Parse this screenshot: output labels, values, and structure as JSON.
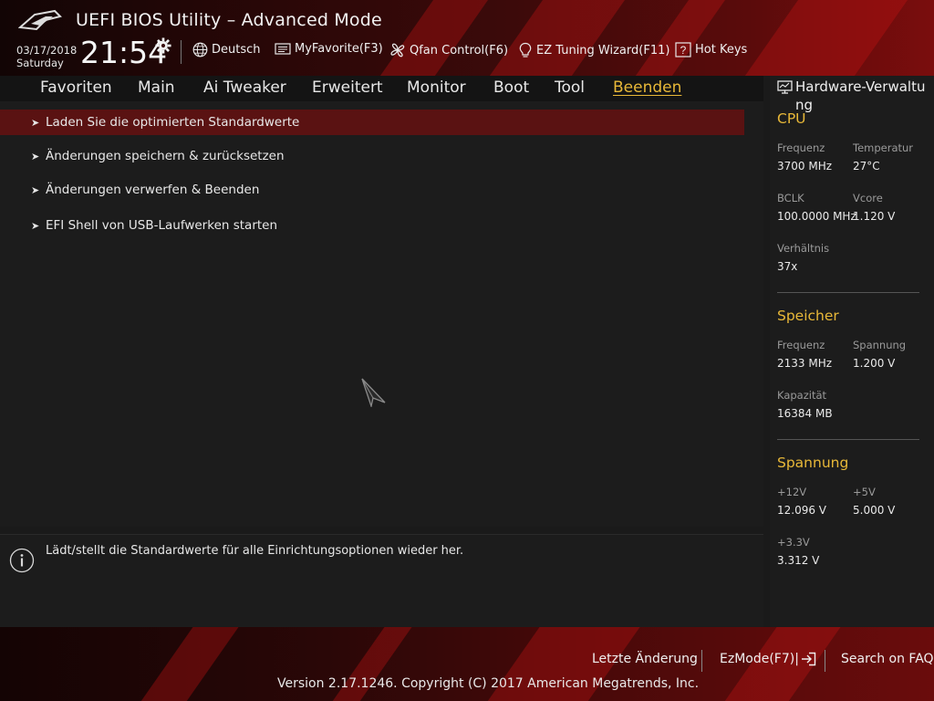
{
  "header": {
    "title": "UEFI BIOS Utility – Advanced Mode",
    "date": "03/17/2018",
    "weekday": "Saturday",
    "time": "21:54",
    "toolbar": {
      "language": "Deutsch",
      "myfavorite": "MyFavorite(F3)",
      "qfan": "Qfan Control(F6)",
      "ez_tuning": "EZ Tuning Wizard(F11)",
      "hotkeys": "Hot Keys"
    }
  },
  "tabs": [
    "Favoriten",
    "Main",
    "Ai Tweaker",
    "Erweitert",
    "Monitor",
    "Boot",
    "Tool",
    "Beenden"
  ],
  "active_tab": "Beenden",
  "menu": {
    "items": [
      {
        "label": "Laden Sie die optimierten Standardwerte",
        "selected": true
      },
      {
        "label": "Änderungen speichern & zurücksetzen",
        "selected": false
      },
      {
        "label": "Änderungen verwerfen & Beenden",
        "selected": false
      },
      {
        "label": "EFI Shell von USB-Laufwerken starten",
        "selected": false
      }
    ]
  },
  "help": {
    "text": "Lädt/stellt die Standardwerte für alle Einrichtungsoptionen wieder her."
  },
  "hardware": {
    "title": "Hardware-Verwaltung",
    "cpu": {
      "title": "CPU",
      "freq_label": "Frequenz",
      "freq_value": "3700 MHz",
      "temp_label": "Temperatur",
      "temp_value": "27°C",
      "bclk_label": "BCLK",
      "bclk_value": "100.0000 MHz",
      "vcore_label": "Vcore",
      "vcore_value": "1.120 V",
      "ratio_label": "Verhältnis",
      "ratio_value": "37x"
    },
    "memory": {
      "title": "Speicher",
      "freq_label": "Frequenz",
      "freq_value": "2133 MHz",
      "volt_label": "Spannung",
      "volt_value": "1.200 V",
      "cap_label": "Kapazität",
      "cap_value": "16384 MB"
    },
    "voltage": {
      "title": "Spannung",
      "v12_label": "+12V",
      "v12_value": "12.096 V",
      "v5_label": "+5V",
      "v5_value": "5.000 V",
      "v33_label": "+3.3V",
      "v33_value": "3.312 V"
    }
  },
  "footer": {
    "last_change": "Letzte Änderung",
    "ezmode": "EzMode(F7)|",
    "faq": "Search on FAQ",
    "copyright": "Version 2.17.1246. Copyright (C) 2017 American Megatrends, Inc."
  },
  "colors": {
    "accent": "#e8b838",
    "selected_row": "#5a1212",
    "background": "#1c1c1c"
  }
}
